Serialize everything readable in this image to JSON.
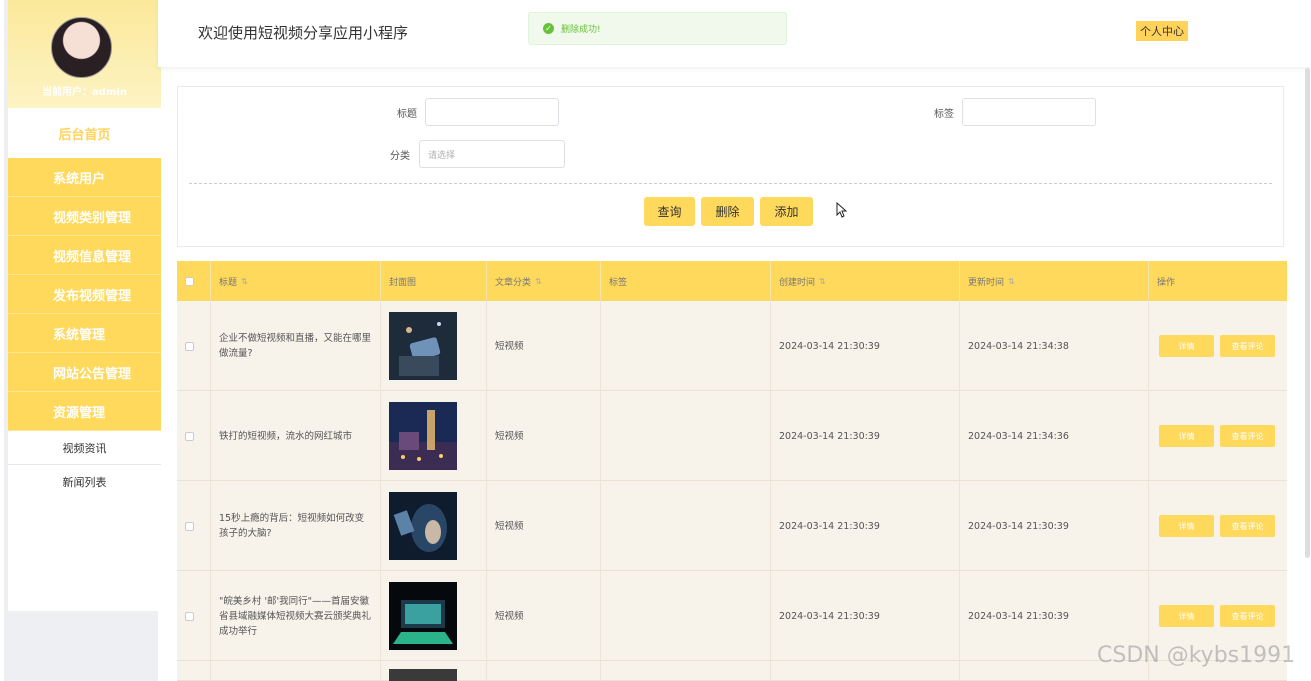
{
  "sidebar": {
    "user_label": "当前用户：admin",
    "home_label": "后台首页",
    "menu": [
      "系统用户",
      "视频类别管理",
      "视频信息管理",
      "发布视频管理",
      "系统管理",
      "网站公告管理",
      "资源管理"
    ],
    "sub_menu": [
      "视频资讯",
      "新闻列表"
    ]
  },
  "header": {
    "title": "欢迎使用短视频分享应用小程序",
    "toast": "删除成功!",
    "user_center": "个人中心"
  },
  "search": {
    "title_label": "标题",
    "tag_label": "标签",
    "category_label": "分类",
    "category_placeholder": "请选择",
    "buttons": {
      "query": "查询",
      "delete": "删除",
      "add": "添加"
    }
  },
  "table": {
    "headers": [
      "标题",
      "封面图",
      "文章分类",
      "标签",
      "创建时间",
      "更新时间",
      "操作"
    ],
    "sort_icon": "⇅",
    "rows": [
      {
        "title": "企业不做短视频和直播，又能在哪里做流量?",
        "category": "短视频",
        "tag": "",
        "created": "2024-03-14 21:30:39",
        "updated": "2024-03-14 21:34:38"
      },
      {
        "title": "铁打的短视频，流水的网红城市",
        "category": "短视频",
        "tag": "",
        "created": "2024-03-14 21:30:39",
        "updated": "2024-03-14 21:34:36"
      },
      {
        "title": "15秒上瘾的背后：短视频如何改变孩子的大脑?",
        "category": "短视频",
        "tag": "",
        "created": "2024-03-14 21:30:39",
        "updated": "2024-03-14 21:30:39"
      },
      {
        "title": "\"皖美乡村 '邮'我同行\"——首届安徽省县域融媒体短视频大赛云颁奖典礼成功举行",
        "category": "短视频",
        "tag": "",
        "created": "2024-03-14 21:30:39",
        "updated": "2024-03-14 21:30:39"
      }
    ],
    "detail_label": "详情",
    "comment_label": "查看评论"
  },
  "watermark": "CSDN @kybs1991",
  "colors": {
    "accent": "#ffd95c",
    "success": "#67c23a",
    "row_bg": "#f7f2ea"
  }
}
